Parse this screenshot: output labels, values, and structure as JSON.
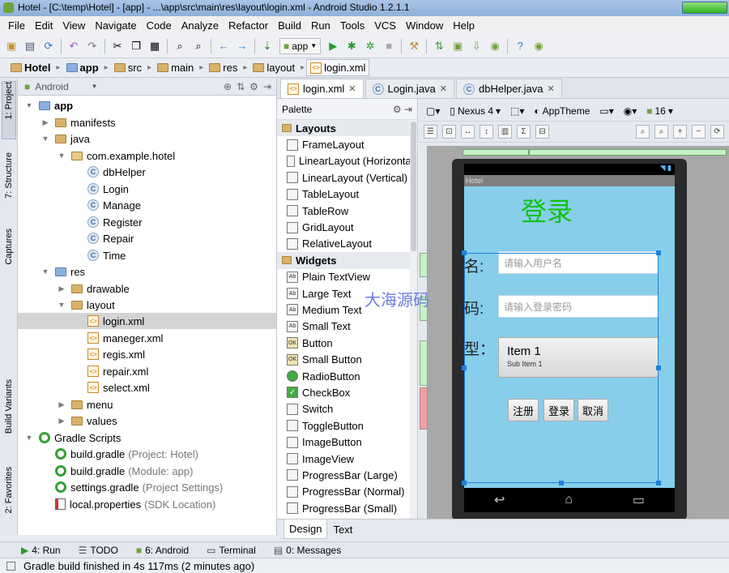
{
  "window": {
    "title": "Hotel - [C:\\temp\\Hotel] - [app] - ...\\app\\src\\main\\res\\layout\\login.xml - Android Studio 1.2.1.1"
  },
  "menu": [
    "File",
    "Edit",
    "View",
    "Navigate",
    "Code",
    "Analyze",
    "Refactor",
    "Build",
    "Run",
    "Tools",
    "VCS",
    "Window",
    "Help"
  ],
  "toolbar": {
    "run_config": "app"
  },
  "breadcrumbs": [
    "Hotel",
    "app",
    "src",
    "main",
    "res",
    "layout",
    "login.xml"
  ],
  "left_tabs": [
    "1: Project",
    "7: Structure",
    "Captures",
    "Build Variants",
    "2: Favorites"
  ],
  "project": {
    "view_mode": "Android",
    "tree": [
      {
        "label": "app",
        "level": 0,
        "icon": "module-icon",
        "expanded": true
      },
      {
        "label": "manifests",
        "level": 1,
        "icon": "folder-icon",
        "expanded": false
      },
      {
        "label": "java",
        "level": 1,
        "icon": "folder-icon",
        "expanded": true
      },
      {
        "label": "com.example.hotel",
        "level": 2,
        "icon": "package-icon",
        "expanded": true
      },
      {
        "label": "dbHelper",
        "level": 3,
        "icon": "class-icon"
      },
      {
        "label": "Login",
        "level": 3,
        "icon": "class-icon"
      },
      {
        "label": "Manage",
        "level": 3,
        "icon": "class-icon"
      },
      {
        "label": "Register",
        "level": 3,
        "icon": "class-icon"
      },
      {
        "label": "Repair",
        "level": 3,
        "icon": "class-icon"
      },
      {
        "label": "Time",
        "level": 3,
        "icon": "class-icon"
      },
      {
        "label": "res",
        "level": 1,
        "icon": "res-folder-icon",
        "expanded": true
      },
      {
        "label": "drawable",
        "level": 2,
        "icon": "folder-icon",
        "expanded": false
      },
      {
        "label": "layout",
        "level": 2,
        "icon": "folder-icon",
        "expanded": true
      },
      {
        "label": "login.xml",
        "level": 3,
        "icon": "xml-icon",
        "selected": true
      },
      {
        "label": "maneger.xml",
        "level": 3,
        "icon": "xml-icon"
      },
      {
        "label": "regis.xml",
        "level": 3,
        "icon": "xml-icon"
      },
      {
        "label": "repair.xml",
        "level": 3,
        "icon": "xml-icon"
      },
      {
        "label": "select.xml",
        "level": 3,
        "icon": "xml-icon"
      },
      {
        "label": "menu",
        "level": 2,
        "icon": "folder-icon",
        "expanded": false
      },
      {
        "label": "values",
        "level": 2,
        "icon": "folder-icon",
        "expanded": false
      },
      {
        "label": "Gradle Scripts",
        "level": 0,
        "icon": "gradle-icon",
        "expanded": true
      },
      {
        "label": "build.gradle",
        "level": 1,
        "icon": "gradle-icon",
        "note": "(Project: Hotel)"
      },
      {
        "label": "build.gradle",
        "level": 1,
        "icon": "gradle-icon",
        "note": "(Module: app)"
      },
      {
        "label": "settings.gradle",
        "level": 1,
        "icon": "gradle-icon",
        "note": "(Project Settings)"
      },
      {
        "label": "local.properties",
        "level": 1,
        "icon": "properties-icon",
        "note": "(SDK Location)"
      }
    ]
  },
  "editor_tabs": [
    {
      "label": "login.xml",
      "active": true
    },
    {
      "label": "Login.java",
      "active": false
    },
    {
      "label": "dbHelper.java",
      "active": false
    }
  ],
  "palette": {
    "title": "Palette",
    "rows": [
      {
        "label": "Layouts",
        "section": true
      },
      {
        "label": "FrameLayout"
      },
      {
        "label": "LinearLayout (Horizontal)"
      },
      {
        "label": "LinearLayout (Vertical)"
      },
      {
        "label": "TableLayout"
      },
      {
        "label": "TableRow"
      },
      {
        "label": "GridLayout"
      },
      {
        "label": "RelativeLayout"
      },
      {
        "label": "Widgets",
        "section": true
      },
      {
        "label": "Plain TextView",
        "icon": "Ab"
      },
      {
        "label": "Large Text",
        "icon": "Ab"
      },
      {
        "label": "Medium Text",
        "icon": "Ab"
      },
      {
        "label": "Small Text",
        "icon": "Ab"
      },
      {
        "label": "Button",
        "icon": "OK"
      },
      {
        "label": "Small Button",
        "icon": "OK"
      },
      {
        "label": "RadioButton"
      },
      {
        "label": "CheckBox"
      },
      {
        "label": "Switch"
      },
      {
        "label": "ToggleButton"
      },
      {
        "label": "ImageButton"
      },
      {
        "label": "ImageView"
      },
      {
        "label": "ProgressBar (Large)"
      },
      {
        "label": "ProgressBar (Normal)"
      },
      {
        "label": "ProgressBar (Small)"
      }
    ]
  },
  "design_toolbar": {
    "device": "Nexus 4",
    "theme": "AppTheme",
    "api": "16"
  },
  "preview": {
    "app_title": "Hotel",
    "heading": "登录",
    "username_label": "名:",
    "username_placeholder": "请输入用户名",
    "password_label": "码:",
    "password_placeholder": "请输入登录密码",
    "type_label": "型：",
    "spinner_item": "Item 1",
    "spinner_subitem": "Sub Item 1",
    "buttons": [
      "注册",
      "登录",
      "取消"
    ]
  },
  "watermark": "大海源码",
  "design_tabs": [
    {
      "label": "Design",
      "active": true
    },
    {
      "label": "Text",
      "active": false
    }
  ],
  "bottom_tools": [
    {
      "label": "4: Run",
      "icon": "run-icon"
    },
    {
      "label": "TODO",
      "icon": "todo-icon"
    },
    {
      "label": "6: Android",
      "icon": "android-icon"
    },
    {
      "label": "Terminal",
      "icon": "terminal-icon"
    },
    {
      "label": "0: Messages",
      "icon": "messages-icon"
    }
  ],
  "status": {
    "message": "Gradle build finished in 4s 117ms (2 minutes ago)"
  },
  "colors": {
    "heading_green": "#11c211",
    "screen_bg": "#87ceeb",
    "selection_blue": "#1e7fe0"
  }
}
